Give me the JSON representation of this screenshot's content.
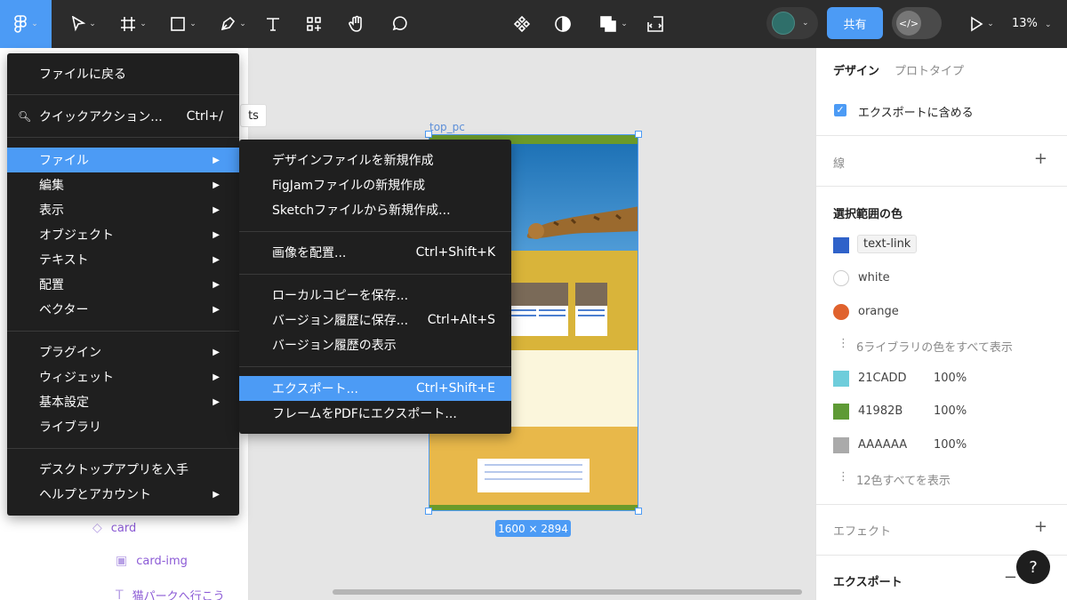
{
  "toolbar": {
    "share_label": "共有",
    "zoom": "13%",
    "dev_icon": "</>"
  },
  "main_menu": {
    "items": [
      {
        "label": "ファイルに戻る"
      },
      {
        "label": "クイックアクション...",
        "shortcut": "Ctrl+/"
      },
      {
        "label": "ファイル"
      },
      {
        "label": "編集"
      },
      {
        "label": "表示"
      },
      {
        "label": "オブジェクト"
      },
      {
        "label": "テキスト"
      },
      {
        "label": "配置"
      },
      {
        "label": "ベクター"
      },
      {
        "label": "プラグイン"
      },
      {
        "label": "ウィジェット"
      },
      {
        "label": "基本設定"
      },
      {
        "label": "ライブラリ"
      },
      {
        "label": "デスクトップアプリを入手"
      },
      {
        "label": "ヘルプとアカウント"
      }
    ]
  },
  "file_menu": {
    "items": [
      {
        "label": "デザインファイルを新規作成"
      },
      {
        "label": "FigJamファイルの新規作成"
      },
      {
        "label": "Sketchファイルから新規作成..."
      },
      {
        "label": "画像を配置...",
        "shortcut": "Ctrl+Shift+K"
      },
      {
        "label": "ローカルコピーを保存..."
      },
      {
        "label": "バージョン履歴に保存...",
        "shortcut": "Ctrl+Alt+S"
      },
      {
        "label": "バージョン履歴の表示"
      },
      {
        "label": "エクスポート...",
        "shortcut": "Ctrl+Shift+E"
      },
      {
        "label": "フレームをPDFにエクスポート..."
      }
    ]
  },
  "canvas": {
    "frame_name": "top_pc",
    "frame_size": "1600 × 2894",
    "floating_label": "ts"
  },
  "layers": [
    {
      "label": "card",
      "icon": "component-icon"
    },
    {
      "label": "card-img",
      "icon": "image-icon"
    },
    {
      "label": "猫パークへ行こう",
      "icon": "text-icon"
    }
  ],
  "right_panel": {
    "tabs": {
      "design": "デザイン",
      "prototype": "プロトタイプ"
    },
    "export_include": "エクスポートに含める",
    "stroke": "線",
    "selection_colors": "選択範囲の色",
    "styles": [
      {
        "name": "text-link",
        "color": "#2f62c9"
      },
      {
        "name": "white",
        "color": "#ffffff"
      },
      {
        "name": "orange",
        "color": "#e0622d"
      }
    ],
    "show_library_colors": "6ライブラリの色をすべて表示",
    "colors": [
      {
        "hex": "21CADD",
        "opacity": "100%",
        "color": "#6ecddb"
      },
      {
        "hex": "41982B",
        "opacity": "100%",
        "color": "#5e9a35"
      },
      {
        "hex": "AAAAAA",
        "opacity": "100%",
        "color": "#aaaaaa"
      }
    ],
    "show_all_colors": "12色すべてを表示",
    "effects": "エフェクト",
    "export": "エクスポート"
  },
  "help_label": "?"
}
